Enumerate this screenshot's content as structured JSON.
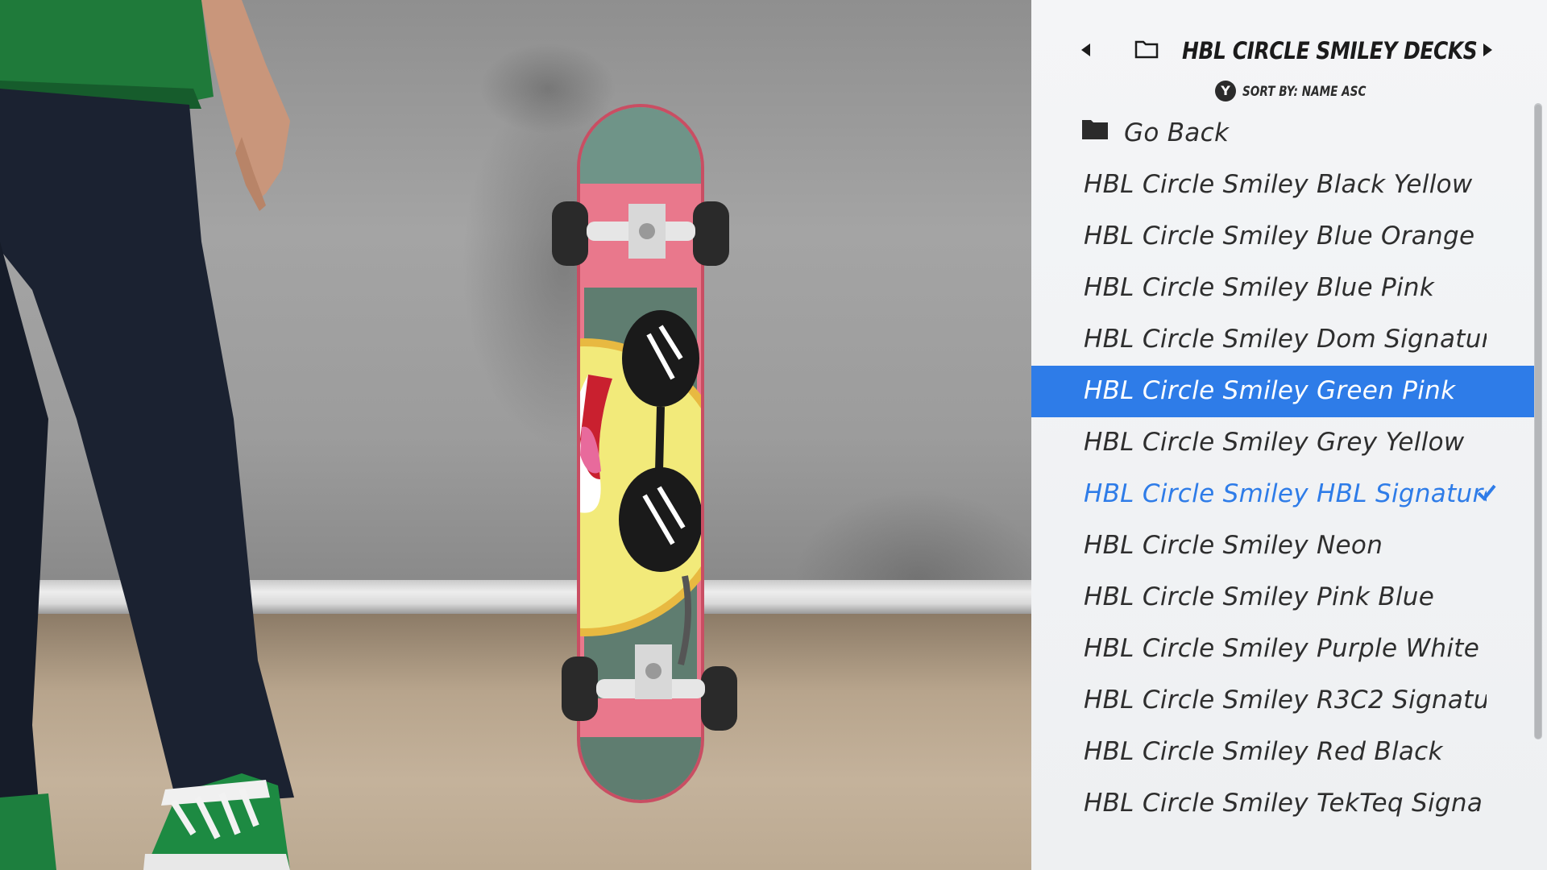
{
  "menu": {
    "category_title": "HBL CIRCLE SMILEY DECKS",
    "sort_button": "Y",
    "sort_label": "SORT BY: NAME ASC",
    "go_back_label": "Go Back",
    "items": [
      {
        "label": "HBL Circle Smiley Black Yellow"
      },
      {
        "label": "HBL Circle Smiley Blue Orange"
      },
      {
        "label": "HBL Circle Smiley Blue Pink"
      },
      {
        "label": "HBL Circle Smiley Dom Signatur"
      },
      {
        "label": "HBL Circle Smiley Green Pink",
        "selected": true
      },
      {
        "label": "HBL Circle Smiley Grey Yellow"
      },
      {
        "label": "HBL Circle Smiley HBL Signature",
        "equipped": true
      },
      {
        "label": "HBL Circle Smiley Neon"
      },
      {
        "label": "HBL Circle Smiley Pink Blue"
      },
      {
        "label": "HBL Circle Smiley Purple White"
      },
      {
        "label": "HBL Circle Smiley R3C2 Signatu"
      },
      {
        "label": "HBL Circle Smiley Red Black"
      },
      {
        "label": "HBL Circle Smiley TekTeq Signa"
      }
    ]
  },
  "icons": {
    "prev": "arrow-left-icon",
    "next": "arrow-right-icon",
    "folder": "folder-icon",
    "equipped": "checkmark-icon"
  },
  "colors": {
    "selection": "#2e7ce8",
    "equipped_text": "#2e7ce8",
    "panel_bg": "#f2f3f5",
    "deck_pink": "#e9788c",
    "deck_green": "#5f7d70",
    "smiley_yellow": "#f2ea7a"
  }
}
